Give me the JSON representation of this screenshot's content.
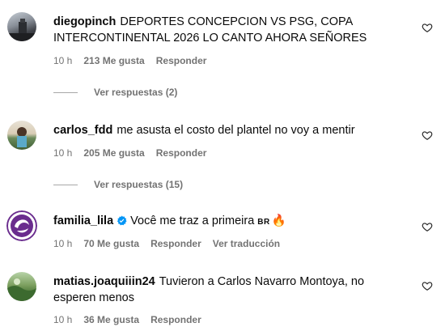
{
  "comments": [
    {
      "username": "diegopinch",
      "text": "DEPORTES CONCEPCION VS PSG, COPA INTERCONTINENTAL 2026 LO CANTO AHORA SEÑORES",
      "time": "10 h",
      "likes": "213 Me gusta",
      "reply": "Responder",
      "view_replies": "Ver respuestas (2)",
      "avatar_icon": "photo-avatar"
    },
    {
      "username": "carlos_fdd",
      "text": "me asusta el costo del plantel no voy a mentir",
      "time": "10 h",
      "likes": "205 Me gusta",
      "reply": "Responder",
      "view_replies": "Ver respuestas (15)",
      "avatar_icon": "photo-avatar"
    },
    {
      "username": "familia_lila",
      "text": "Você me traz a primeira",
      "flag": "BR",
      "emoji": "🔥",
      "time": "10 h",
      "likes": "70 Me gusta",
      "reply": "Responder",
      "translate": "Ver traducción",
      "verified_icon": "verified-badge-icon",
      "avatar_icon": "logo-avatar"
    },
    {
      "username": "matias.joaquiiin24",
      "text": "Tuvieron a Carlos Navarro Montoya, no esperen menos",
      "time": "10 h",
      "likes": "36 Me gusta",
      "reply": "Responder",
      "avatar_icon": "photo-avatar"
    }
  ],
  "colors": {
    "meta": "#737373",
    "verified": "#0095f6",
    "logo_purple": "#6a2c8e"
  }
}
